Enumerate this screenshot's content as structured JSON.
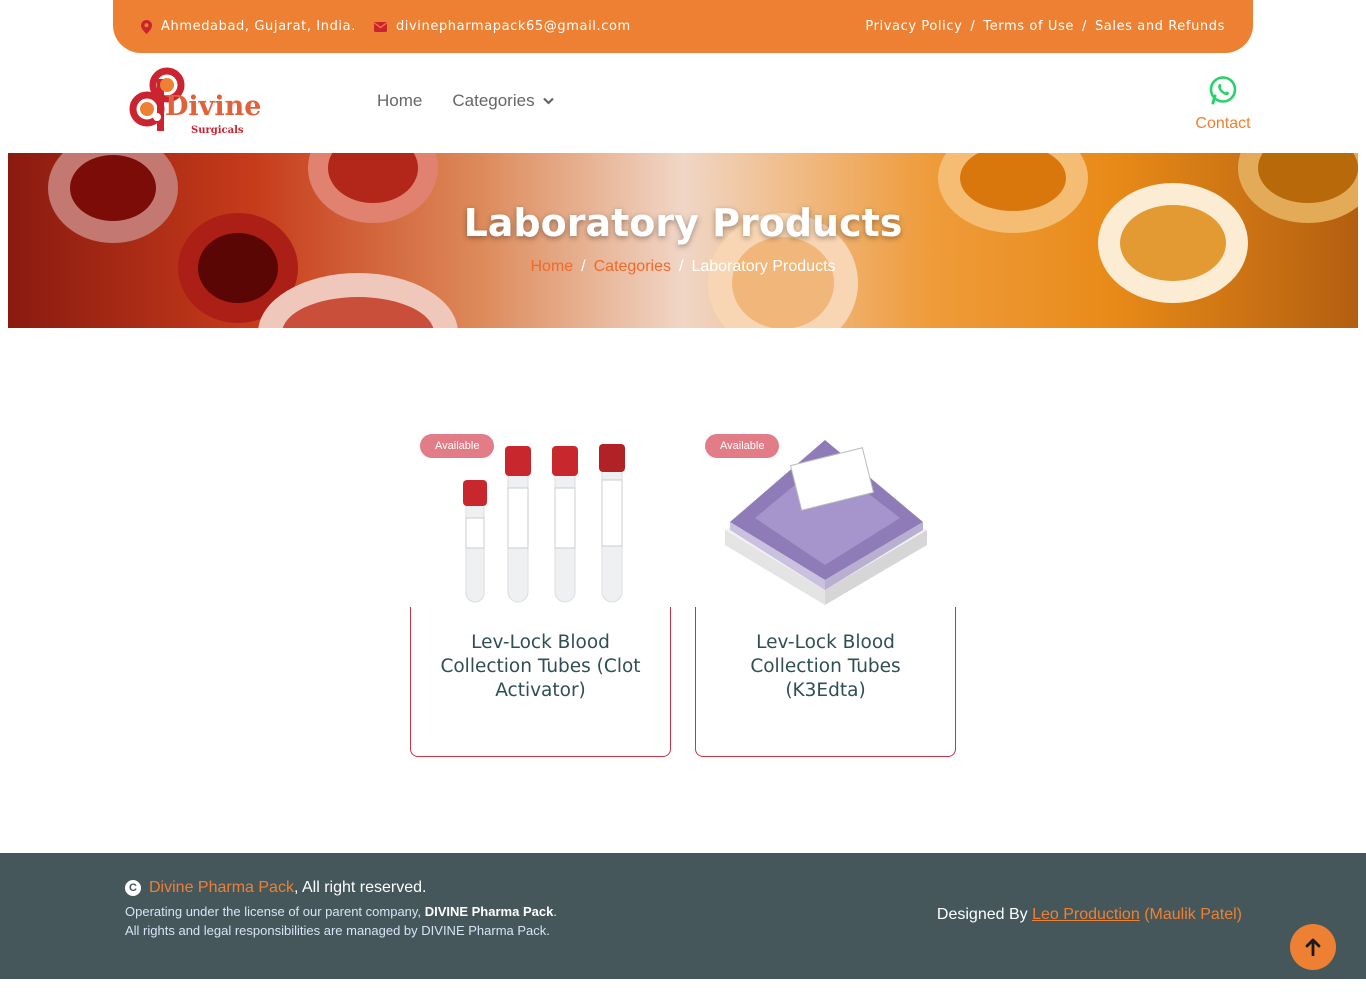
{
  "topbar": {
    "location": "Ahmedabad, Gujarat, India.",
    "email": "divinepharmapack65@gmail.com",
    "links": [
      "Privacy Policy",
      "Terms of Use",
      "Sales and Refunds"
    ],
    "separator": "/"
  },
  "logo": {
    "brand": "Divine",
    "sub": "Surgicals"
  },
  "nav": {
    "home": "Home",
    "categories": "Categories"
  },
  "contact": {
    "label": "Contact",
    "icon": "whatsapp-icon"
  },
  "hero": {
    "title": "Laboratory Products",
    "breadcrumb": [
      "Home",
      "Categories",
      "Laboratory Products"
    ],
    "separator": "/"
  },
  "products": [
    {
      "badge": "Available",
      "name": "Lev-Lock Blood Collection Tubes (Clot Activator)"
    },
    {
      "badge": "Available",
      "name": "Lev-Lock Blood Collection Tubes (K3Edta)"
    }
  ],
  "footer": {
    "brand": "Divine Pharma Pack",
    "rights": ", All right reserved.",
    "license_prefix": "Operating under the license of our parent company,",
    "license_company": "DIVINE Pharma Pack",
    "license_suffix": ".",
    "responsibility": "All rights and legal responsibilities are managed by DIVINE Pharma Pack.",
    "designed_by": "Designed By",
    "designer": "Leo Production",
    "designer_person": "(Maulik Patel)"
  },
  "colors": {
    "accent": "#ee8033",
    "footer_bg": "#45575b",
    "card_border": "#c8344a",
    "badge": "#e27c86",
    "whatsapp": "#25d366"
  }
}
